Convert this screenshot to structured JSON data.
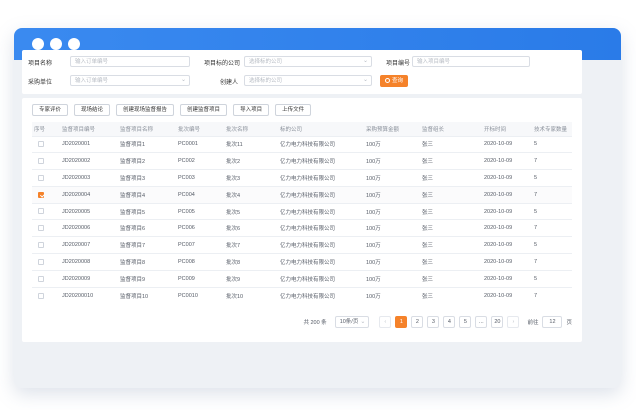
{
  "window": {
    "title_dots": 3
  },
  "filters": {
    "project_name": {
      "label": "项目名称",
      "placeholder": "输入订单编号"
    },
    "supervisor_company": {
      "label": "项目标的公司",
      "placeholder": "选择标的公司"
    },
    "project_code": {
      "label": "项目编号",
      "placeholder": "输入项目编号"
    },
    "purchase_unit": {
      "label": "采购单位",
      "placeholder": "输入订单编号"
    },
    "creator": {
      "label": "创建人",
      "placeholder": "选择标的公司"
    },
    "search_label": "查询"
  },
  "toolbar": {
    "buttons": [
      "专家评价",
      "现场结论",
      "创建现场监督报告",
      "创建监督项目",
      "导入项目",
      "上传文件"
    ]
  },
  "table": {
    "columns": [
      "序号",
      "监督项目编号",
      "监督项目名称",
      "批次编号",
      "批次名称",
      "标的公司",
      "采购预算金额",
      "监督组长",
      "开标时间",
      "技术专家数量"
    ],
    "rows": [
      {
        "checked": false,
        "code": "JD2020001",
        "name": "监督项目1",
        "batch_code": "PC0001",
        "batch_name": "批次11",
        "company": "亿力电力科技有限公司",
        "budget": "100万",
        "leader": "张三",
        "open_time": "2020-10-09",
        "experts": "5"
      },
      {
        "checked": false,
        "code": "JD2020002",
        "name": "监督项目2",
        "batch_code": "PC002",
        "batch_name": "批次2",
        "company": "亿力电力科技有限公司",
        "budget": "100万",
        "leader": "张三",
        "open_time": "2020-10-09",
        "experts": "7"
      },
      {
        "checked": false,
        "code": "JD2020003",
        "name": "监督项目3",
        "batch_code": "PC003",
        "batch_name": "批次3",
        "company": "亿力电力科技有限公司",
        "budget": "100万",
        "leader": "张三",
        "open_time": "2020-10-09",
        "experts": "5"
      },
      {
        "checked": true,
        "code": "JD2020004",
        "name": "监督项目4",
        "batch_code": "PC004",
        "batch_name": "批次4",
        "company": "亿力电力科技有限公司",
        "budget": "100万",
        "leader": "张三",
        "open_time": "2020-10-09",
        "experts": "7"
      },
      {
        "checked": false,
        "code": "JD2020005",
        "name": "监督项目5",
        "batch_code": "PC005",
        "batch_name": "批次5",
        "company": "亿力电力科技有限公司",
        "budget": "100万",
        "leader": "张三",
        "open_time": "2020-10-09",
        "experts": "5"
      },
      {
        "checked": false,
        "code": "JD2020006",
        "name": "监督项目6",
        "batch_code": "PC006",
        "batch_name": "批次6",
        "company": "亿力电力科技有限公司",
        "budget": "100万",
        "leader": "张三",
        "open_time": "2020-10-09",
        "experts": "7"
      },
      {
        "checked": false,
        "code": "JD2020007",
        "name": "监督项目7",
        "batch_code": "PC007",
        "batch_name": "批次7",
        "company": "亿力电力科技有限公司",
        "budget": "100万",
        "leader": "张三",
        "open_time": "2020-10-09",
        "experts": "5"
      },
      {
        "checked": false,
        "code": "JD2020008",
        "name": "监督项目8",
        "batch_code": "PC008",
        "batch_name": "批次8",
        "company": "亿力电力科技有限公司",
        "budget": "100万",
        "leader": "张三",
        "open_time": "2020-10-09",
        "experts": "7"
      },
      {
        "checked": false,
        "code": "JD2020009",
        "name": "监督项目9",
        "batch_code": "PC009",
        "batch_name": "批次9",
        "company": "亿力电力科技有限公司",
        "budget": "100万",
        "leader": "张三",
        "open_time": "2020-10-09",
        "experts": "5"
      },
      {
        "checked": false,
        "code": "JD20200010",
        "name": "监督项目10",
        "batch_code": "PC0010",
        "batch_name": "批次10",
        "company": "亿力电力科技有限公司",
        "budget": "100万",
        "leader": "张三",
        "open_time": "2020-10-09",
        "experts": "7"
      }
    ]
  },
  "pagination": {
    "total": "共 200 条",
    "page_size": "10条/页",
    "prev": "‹",
    "pages": [
      "1",
      "2",
      "3",
      "4",
      "5",
      "...",
      "20"
    ],
    "active_page": "1",
    "next": "›",
    "jump_label": "前往",
    "jump_value": "12",
    "jump_suffix": "页"
  },
  "colors": {
    "accent": "#f5822a",
    "titlebar": "#2a7be8"
  }
}
